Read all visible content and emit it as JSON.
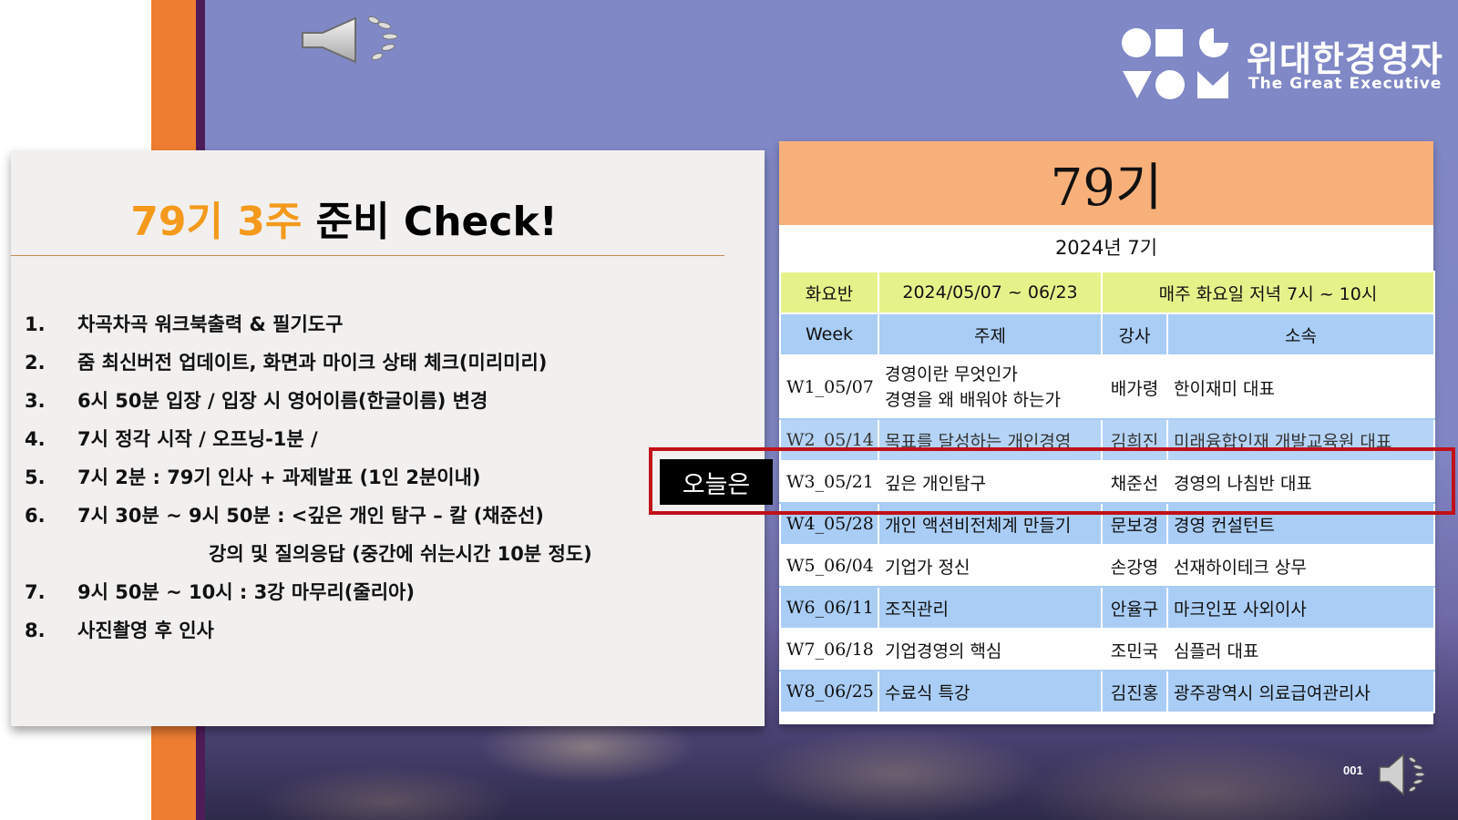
{
  "slide": {
    "page_number": "001",
    "colors": {
      "background": "#8088c6",
      "accent_orange": "#ee7d31",
      "accent_purple": "#4f1c5a",
      "highlight_red": "#c0101a"
    }
  },
  "logo": {
    "name_kr": "위대한경영자",
    "name_en": "The Great Executive"
  },
  "icons": {
    "top": "speaker-icon",
    "bottom": "speaker-icon"
  },
  "panel": {
    "title_highlight": "79기 3주",
    "title_rest": " 준비 Check!",
    "agenda": [
      {
        "num": "1.",
        "text": "차곡차곡 워크북출력 & 필기도구"
      },
      {
        "num": "2.",
        "text": "줌 최신버전 업데이트, 화면과 마이크 상태 체크(미리미리)"
      },
      {
        "num": "3.",
        "text": "6시 50분 입장 / 입장 시 영어이름(한글이름) 변경"
      },
      {
        "num": "4.",
        "text": "7시 정각 시작 / 오프닝-1분 /"
      },
      {
        "num": "5.",
        "text": "7시 2분 : 79기 인사 + 과제발표 (1인 2분이내)"
      },
      {
        "num": "6.",
        "text": "7시 30분 ~ 9시 50분 : <깊은 개인 탐구 – 칼 (채준선)"
      },
      {
        "num": "",
        "text": "강의 및 질의응답 (중간에 쉬는시간 10분 정도)"
      },
      {
        "num": "7.",
        "text": " 9시 50분 ~ 10시 : 3강 마무리(줄리아)"
      },
      {
        "num": "8.",
        "text": " 사진촬영 후 인사"
      }
    ]
  },
  "today_label": "오늘은",
  "schedule": {
    "title": "79기",
    "subtitle": "2024년 7기",
    "info": {
      "class": "화요반",
      "period": "2024/05/07 ~ 06/23",
      "time": "매주 화요일 저녁 7시 ~ 10시"
    },
    "headers": {
      "week": "Week",
      "topic": "주제",
      "instructor": "강사",
      "affiliation": "소속"
    },
    "rows": [
      {
        "week": "W1_05/07",
        "topic_line1": "경영이란 무엇인가",
        "topic_line2": "경영을 왜 배워야 하는가",
        "instructor": "배가령",
        "affiliation": "한이재미 대표"
      },
      {
        "week": "W2_05/14",
        "topic": "목표를 달성하는 개인경영",
        "instructor": "김희진",
        "affiliation": "미래융합인재 개발교육원 대표"
      },
      {
        "week": "W3_05/21",
        "topic": "깊은 개인탐구",
        "instructor": "채준선",
        "affiliation": "경영의 나침반 대표"
      },
      {
        "week": "W4_05/28",
        "topic": "개인 액션비전체계 만들기",
        "instructor": "문보경",
        "affiliation": "경영 컨설턴트"
      },
      {
        "week": "W5_06/04",
        "topic": "기업가 정신",
        "instructor": "손강영",
        "affiliation": "선재하이테크 상무"
      },
      {
        "week": "W6_06/11",
        "topic": "조직관리",
        "instructor": "안율구",
        "affiliation": "마크인포 사외이사"
      },
      {
        "week": "W7_06/18",
        "topic": "기업경영의 핵심",
        "instructor": "조민국",
        "affiliation": "심플러 대표"
      },
      {
        "week": "W8_06/25",
        "topic": "수료식 특강",
        "instructor": "김진홍",
        "affiliation": "광주광역시 의료급여관리사"
      }
    ]
  }
}
